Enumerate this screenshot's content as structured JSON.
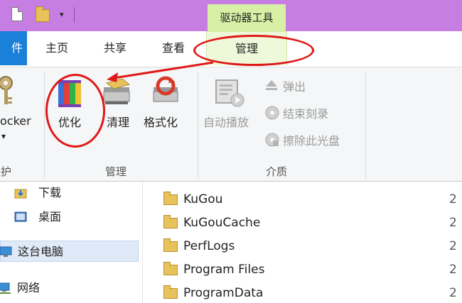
{
  "ribbon_context": {
    "title": "驱动器工具"
  },
  "tabs": {
    "file": "件",
    "home": "主页",
    "share": "共享",
    "view": "查看",
    "manage": "管理"
  },
  "ribbon": {
    "bitlocker": {
      "label": "ocker",
      "arrow": "▾"
    },
    "protect_group": "保护",
    "optimize": "优化",
    "cleanup": "清理",
    "format": "格式化",
    "manage_group": "管理",
    "autoplay": "自动播放",
    "eject": "弹出",
    "finish_burn": "结束刻录",
    "erase_disc": "擦除此光盘",
    "media_group": "介质"
  },
  "nav": {
    "items": [
      {
        "label": "下载",
        "icon": "download-folder-icon"
      },
      {
        "label": "桌面",
        "icon": "desktop-icon"
      },
      {
        "label": "这台电脑",
        "icon": "this-pc-icon",
        "selected": true
      },
      {
        "label": "网络",
        "icon": "network-icon"
      }
    ]
  },
  "files": [
    {
      "name": "KuGou",
      "date": "2"
    },
    {
      "name": "KuGouCache",
      "date": "2"
    },
    {
      "name": "PerfLogs",
      "date": "2"
    },
    {
      "name": "Program Files",
      "date": "2"
    },
    {
      "name": "ProgramData",
      "date": "2"
    }
  ],
  "colors": {
    "titlebar": "#c77ee3",
    "context_tab": "#d7f0a6",
    "file_tab": "#1b80d7",
    "annotation": "#e01818"
  }
}
